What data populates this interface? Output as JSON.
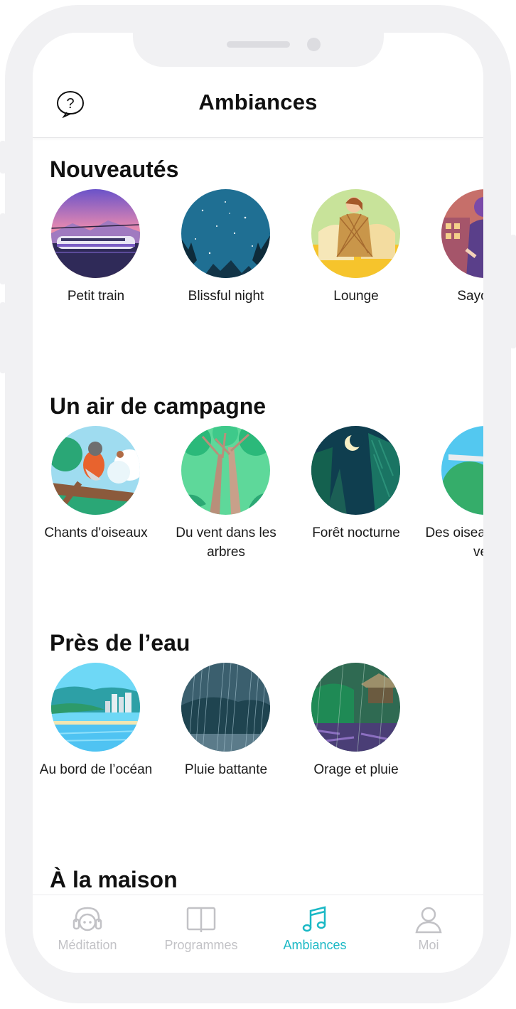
{
  "header": {
    "title": "Ambiances",
    "help_icon": "question-bubble-icon"
  },
  "sections": [
    {
      "title": "Nouveautés",
      "items": [
        {
          "label": "Petit train"
        },
        {
          "label": "Blissful night"
        },
        {
          "label": "Lounge"
        },
        {
          "label": "Sayonara"
        }
      ]
    },
    {
      "title": "Un air de campagne",
      "items": [
        {
          "label": "Chants d'oiseaux"
        },
        {
          "label": "Du vent dans les arbres"
        },
        {
          "label": "Forêt nocturne"
        },
        {
          "label": "Des oiseaux dans le vent"
        }
      ]
    },
    {
      "title": "Près de l’eau",
      "items": [
        {
          "label": "Au bord de l’océan"
        },
        {
          "label": "Pluie battante"
        },
        {
          "label": "Orage et pluie"
        }
      ]
    },
    {
      "title": "À la maison",
      "items": []
    }
  ],
  "tabbar": {
    "tabs": [
      {
        "label": "Méditation",
        "icon": "headphones-face-icon",
        "active": false
      },
      {
        "label": "Programmes",
        "icon": "open-book-icon",
        "active": false
      },
      {
        "label": "Ambiances",
        "icon": "music-note-icon",
        "active": true
      },
      {
        "label": "Moi",
        "icon": "user-icon",
        "active": false
      }
    ]
  },
  "colors": {
    "accent": "#1ab8c5",
    "inactive": "#c2c2c6",
    "frame": "#f1f1f3"
  }
}
